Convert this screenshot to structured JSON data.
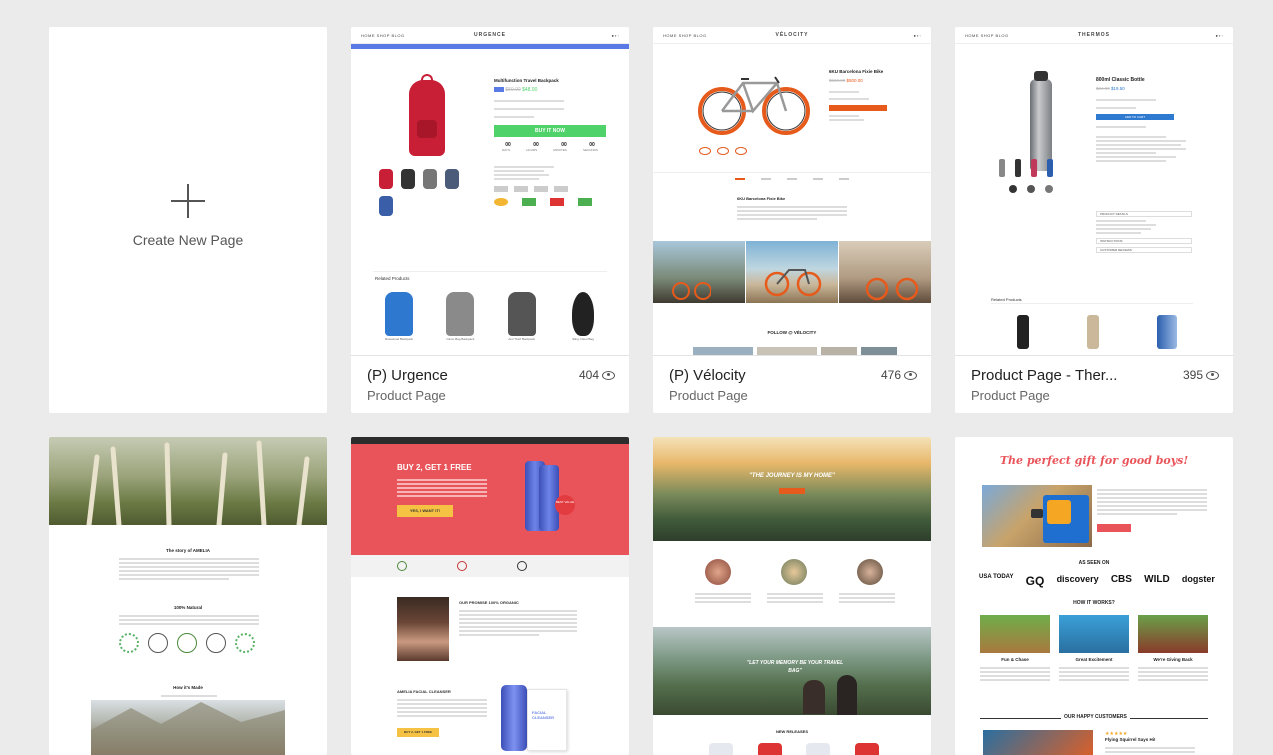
{
  "create": {
    "label": "Create New Page"
  },
  "cards": [
    {
      "title": "(P) Urgence",
      "type": "Product Page",
      "views": "404"
    },
    {
      "title": "(P) Vélocity",
      "type": "Product Page",
      "views": "476"
    },
    {
      "title": "Product Page - Ther...",
      "type": "Product Page",
      "views": "395"
    }
  ],
  "thumbs": {
    "urgence": {
      "nav_links": "HOME SHOP BLOG",
      "brand": "URGENCE",
      "product": "Multifunction Travel Backpack",
      "price": "$48.00",
      "old_price": "$59.00",
      "cta": "BUY IT NOW",
      "countdown": [
        "00",
        "00",
        "00",
        "00"
      ],
      "countdown_labels": [
        "DAYS",
        "HOURS",
        "MINUTES",
        "SECONDS"
      ],
      "related": "Related Products",
      "related_items": [
        "Rosewood Backpack",
        "Camo Bag Backpack",
        "Anti Theft Backpack",
        "Sling Chest Bag"
      ]
    },
    "velocity": {
      "nav_links": "HOME SHOP BLOG",
      "brand": "VÉLOCITY",
      "product": "6KU Barcelona Fixie Bike",
      "price": "$500.00",
      "old_price": "$560.00",
      "section": "6KU Barcelona Fixie Bike",
      "follow": "FOLLOW @ VÉLOCITY"
    },
    "thermos": {
      "nav_links": "HOME SHOP BLOG",
      "brand": "THERMOS",
      "product": "800ml Classic Bottle",
      "price": "$19.50",
      "old_price": "$24.00",
      "cta": "ADD TO CART",
      "related": "Related Products",
      "accordion": [
        "PRODUCT DETAILS",
        "INSTRUCTIONS",
        "CUSTOMER REVIEWS"
      ]
    },
    "amelia": {
      "heading1": "The story of AMELIA",
      "heading2": "100% Natural",
      "heading3": "How it's Made"
    },
    "organic": {
      "headline": "BUY 2, GET 1 FREE",
      "cta": "YES, I WANT IT!",
      "section": "OUR PROMISE 100% ORGANIC",
      "product": "AMELIA FACIAL CLEANSER",
      "cta2": "BUY 2, GET 1 FREE",
      "badge": "BEST VALUE",
      "bottle_label": "FACIAL CLEANSER"
    },
    "journey": {
      "hero": "\"THE JOURNEY IS MY HOME\"",
      "quote": "\"LET YOUR MEMORY BE YOUR TRAVEL BAG\"",
      "releases": "NEW RELEASES"
    },
    "gift": {
      "headline": "The perfect gift for good boys!",
      "seen": "AS SEEN ON",
      "logos": [
        "USA TODAY",
        "GQ",
        "discovery",
        "CBS",
        "WILD",
        "dogster"
      ],
      "how": "HOW IT WORKS?",
      "steps": [
        "Fun & Chase",
        "Great Excitement",
        "We're Giving Back"
      ],
      "customers": "OUR HAPPY CUSTOMERS",
      "review": "Flying Squirrel Says Hi!"
    }
  },
  "colors": {
    "background": "#ebebeb",
    "card": "#ffffff",
    "accent_green": "#4fd26a",
    "accent_red": "#e9545a",
    "accent_blue": "#2e7ad1"
  }
}
